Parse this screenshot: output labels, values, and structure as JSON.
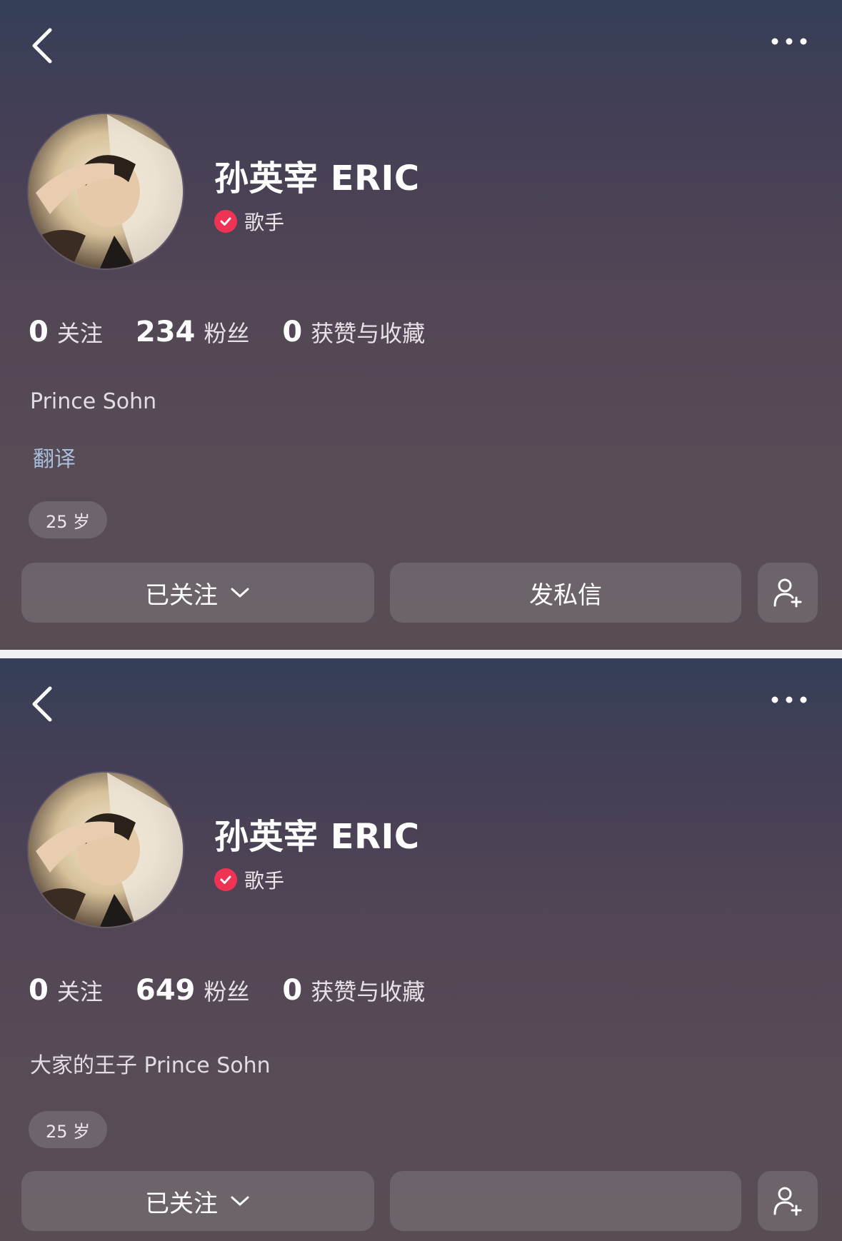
{
  "screens": [
    {
      "name": "孙英宰 ERIC",
      "verify_label": "歌手",
      "stats": [
        {
          "value": "0",
          "label": "关注"
        },
        {
          "value": "234",
          "label": "粉丝"
        },
        {
          "value": "0",
          "label": "获赞与收藏"
        }
      ],
      "bio": "Prince Sohn",
      "translate_label": "翻译",
      "age_tag": "25 岁",
      "follow_button": "已关注",
      "message_button": "发私信"
    },
    {
      "name": "孙英宰 ERIC",
      "verify_label": "歌手",
      "stats": [
        {
          "value": "0",
          "label": "关注"
        },
        {
          "value": "649",
          "label": "粉丝"
        },
        {
          "value": "0",
          "label": "获赞与收藏"
        }
      ],
      "bio": "大家的王子 Prince Sohn",
      "age_tag": "25 岁",
      "follow_button": "已关注"
    }
  ],
  "icons": {
    "back": "chevron-left-icon",
    "more": "more-dots-icon",
    "verified": "verified-check-icon",
    "add_friend": "add-user-icon",
    "dropdown": "chevron-down-icon"
  },
  "colors": {
    "verified_badge": "#ee3355",
    "translate_link": "#a9bfdb"
  }
}
